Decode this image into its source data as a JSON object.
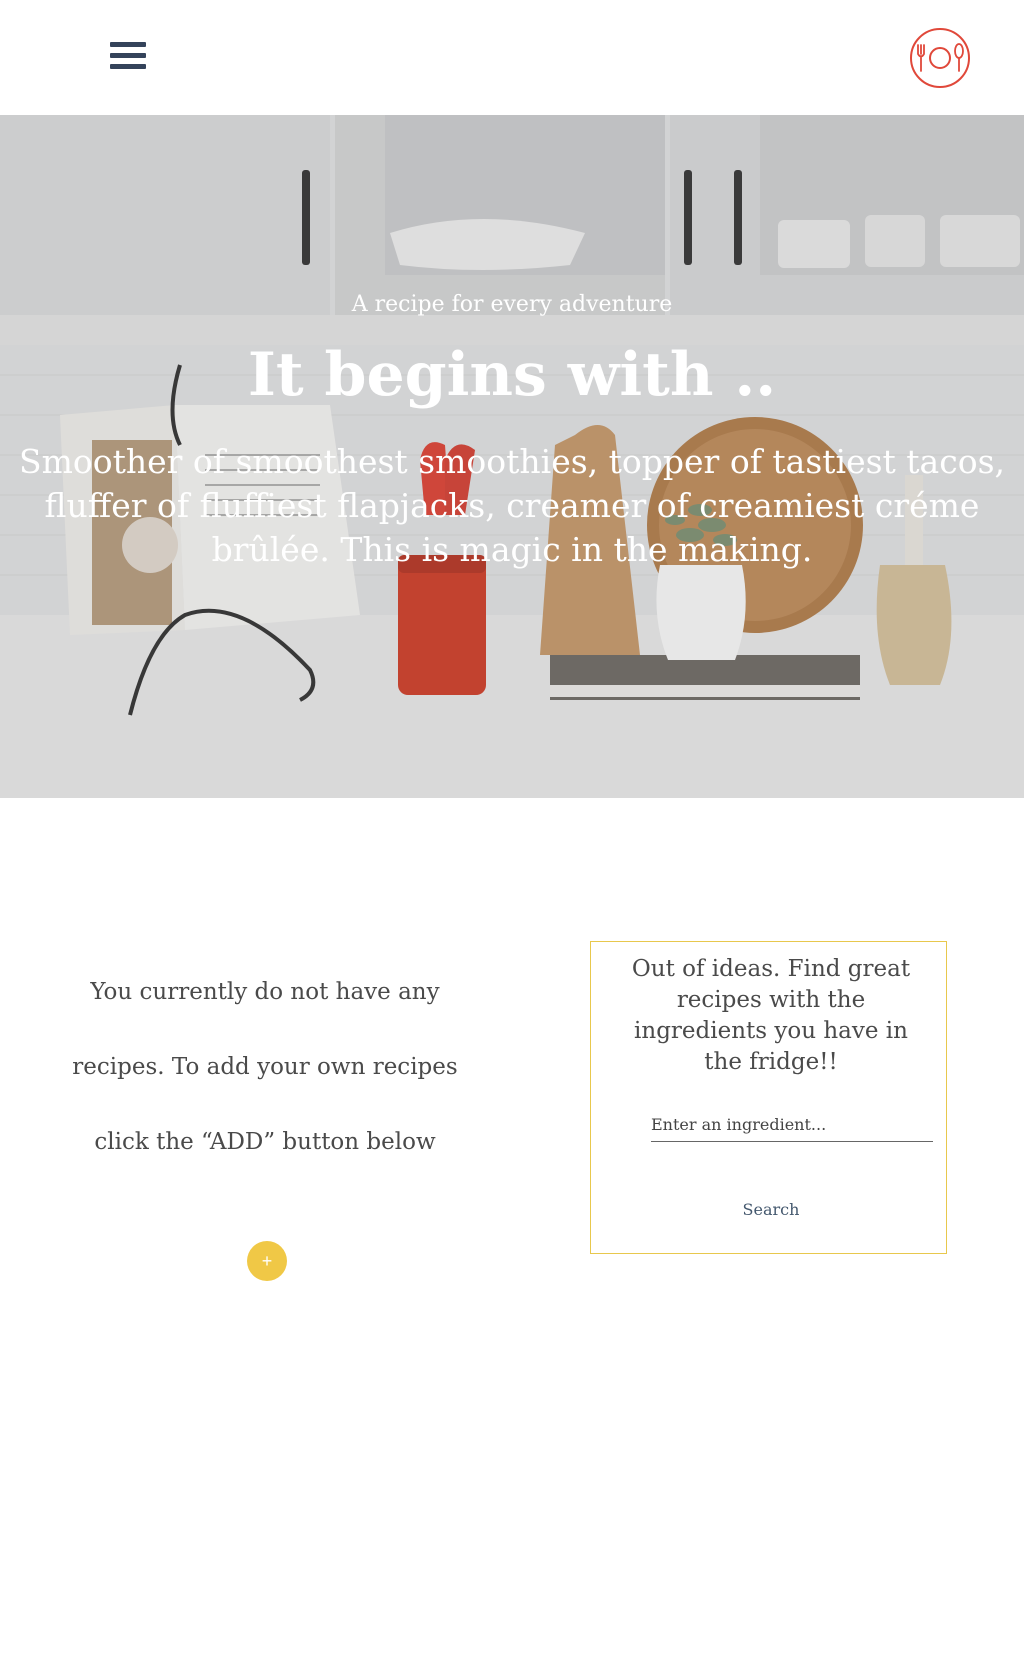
{
  "header": {
    "menu_icon": "hamburger-menu-icon",
    "logo_icon": "plate-fork-spoon-icon",
    "logo_color": "#e0483a"
  },
  "hero": {
    "kicker": "A recipe for every adventure",
    "title": "It begins with ..",
    "body": "Smoother of smoothest smoothies, topper of tastiest tacos, fluffer of fluffiest flapjacks, creamer of creamiest créme brûlée. This is magic in the making."
  },
  "info": {
    "line1": "You currently do not have any",
    "line2": "recipes. To add your own recipes",
    "line3": "click the “ADD” button below",
    "add_label": "+"
  },
  "search_card": {
    "text": "Out of ideas. Find great recipes with the ingredients you have in the fridge!!",
    "placeholder": "Enter an ingredient...",
    "button_label": "Search",
    "border_color": "#e8c84d"
  },
  "colors": {
    "accent": "#f0c846",
    "nav": "#34435a"
  }
}
